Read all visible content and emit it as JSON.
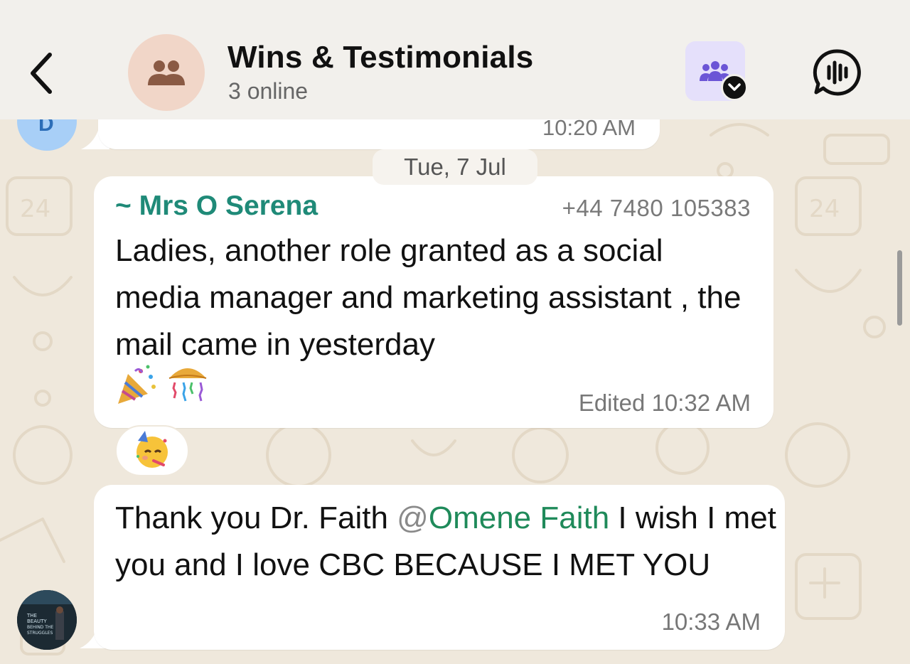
{
  "header": {
    "title": "Wins & Testimonials",
    "subtitle": "3 online",
    "icons": {
      "back": "chevron-left-icon",
      "group": "group-people-icon",
      "community": "community-icon",
      "dropdown": "chevron-down-icon",
      "voice_chat": "voice-chat-icon"
    }
  },
  "previous_message": {
    "avatar_initial": "D",
    "time": "10:20 AM"
  },
  "date_divider": "Tue, 7 Jul",
  "messages": [
    {
      "sender": "~ Mrs O Serena",
      "phone": "+44 7480 105383",
      "text": "Ladies, another role granted as a social media manager and marketing assistant , the mail came in yesterday",
      "emojis": "🎉🎊",
      "edited_label": "Edited",
      "time": "10:32 AM",
      "reaction": "🥳"
    },
    {
      "text_before": "Thank you Dr. Faith ",
      "mention_at": "@",
      "mention_name": "Omene Faith",
      "text_after": " I wish I met you and I love CBC BECAUSE I MET YOU",
      "time": "10:33 AM",
      "avatar_book_text": "THE BEAUTY BEHIND THE STRUGGLES"
    }
  ],
  "colors": {
    "sender_name": "#1f8a78",
    "mention": "#1f8a5a",
    "header_bg": "#f2f0ec",
    "wallpaper": "#efe8dc"
  }
}
